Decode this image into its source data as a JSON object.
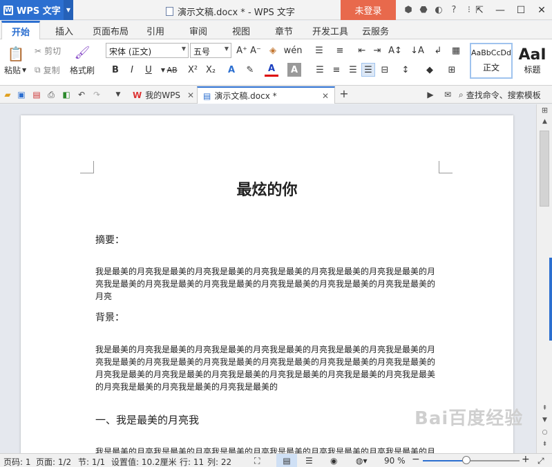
{
  "app": {
    "name": "WPS 文字",
    "window_title": "演示文稿.docx * - WPS 文字",
    "login_label": "未登录"
  },
  "menu_tabs": [
    "开始",
    "插入",
    "页面布局",
    "引用",
    "审阅",
    "视图",
    "章节",
    "开发工具",
    "云服务"
  ],
  "ribbon": {
    "paste": "粘贴",
    "cut": "剪切",
    "copy": "复制",
    "format_painter": "格式刷",
    "font_name": "宋体 (正文)",
    "font_size": "五号",
    "bold": "B",
    "italic": "I",
    "underline": "U",
    "strike": "AB",
    "superscript": "X²",
    "subscript": "X₂",
    "text_effect": "A",
    "font_color": "A",
    "char_shade": "A",
    "style_normal_preview": "AaBbCcDd",
    "style_normal_name": "正文",
    "style_heading_preview": "AaI",
    "style_heading_name": "标题"
  },
  "quick_bar": {
    "tab_home": "我的WPS",
    "tab_doc": "演示文稿.docx *",
    "add_tab": "+",
    "search_placeholder": "查找命令、搜索模板"
  },
  "document": {
    "title": "最炫的你",
    "abstract_label": "摘要：",
    "abstract_text": "我是最美的月亮我是最美的月亮我是最美的月亮我是最美的月亮我是最美的月亮我是最美的月亮我是最美的月亮我是最美的月亮我是最美的月亮我是最美的月亮我是最美的月亮我是最美的月亮",
    "background_label": "背景：",
    "background_text": "我是最美的月亮我是最美的月亮我是最美的月亮我是最美的月亮我是最美的月亮我是最美的月亮我是最美的月亮我是最美的月亮我是最美的月亮我是最美的月亮我是最美的月亮我是最美的月亮我是最美的月亮我是最美的月亮我是最美的月亮我是最美的月亮我是最美的月亮我是最美的月亮我是最美的月亮我是最美的月亮我是最美的",
    "section1": "一、我是最美的月亮我",
    "section1_text": "我是最美的月亮我是最美的月亮我是最美的月亮我是最美的月亮我是最美的月亮我是最美的月亮我是最美"
  },
  "status": {
    "page_code": "页码: 1",
    "page": "页面: 1/2",
    "section": "节: 1/1",
    "setting": "设置值: 10.2厘米",
    "row": "行: 11",
    "col": "列: 22",
    "zoom": "90 %",
    "zoom_value": 0.45
  },
  "watermark": "Bai百度经验",
  "colors": {
    "accent": "#2c6fd0",
    "login": "#e8694c"
  }
}
